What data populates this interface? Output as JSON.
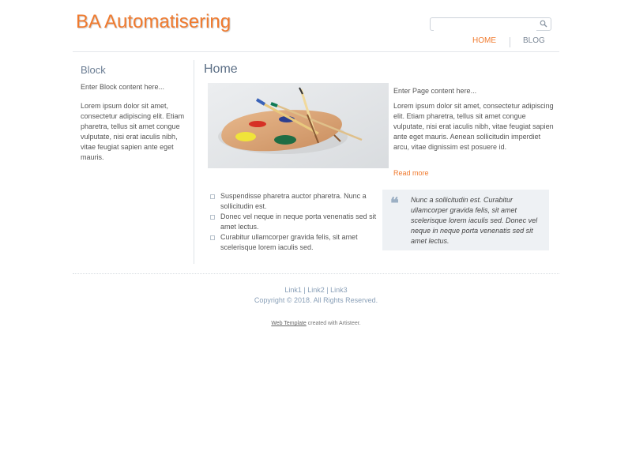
{
  "header": {
    "logo": "BA Automatisering",
    "search": {
      "placeholder": "",
      "value": ""
    },
    "nav": [
      {
        "label": "HOME",
        "active": true
      },
      {
        "label": "BLOG",
        "active": false
      }
    ]
  },
  "sidebar": {
    "title": "Block",
    "text1": "Enter Block content here...",
    "text2": "Lorem ipsum dolor sit amet, consectetur adipiscing elit. Etiam pharetra, tellus sit amet congue vulputate, nisi erat iaculis nibh, vitae feugiat sapien ante eget mauris."
  },
  "main": {
    "title": "Home",
    "intro": "Enter Page content here...",
    "body": "Lorem ipsum dolor sit amet, consectetur adipiscing elit. Etiam pharetra, tellus sit amet congue vulputate, nisi erat iaculis nibh, vitae feugiat sapien ante eget mauris. Aenean sollicitudin imperdiet arcu, vitae dignissim est posuere id.",
    "read_more": "Read more",
    "bullets": [
      "Suspendisse pharetra auctor pharetra. Nunc a sollicitudin est.",
      "Donec vel neque in neque porta venenatis sed sit amet lectus.",
      "Curabitur ullamcorper gravida felis, sit amet scelerisque lorem iaculis sed."
    ],
    "quote": "Nunc a sollicitudin est. Curabitur ullamcorper gravida felis, sit amet scelerisque lorem iaculis sed. Donec vel neque in neque porta venenatis sed sit amet lectus."
  },
  "footer": {
    "link1": "Link1",
    "link2": "Link2",
    "link3": "Link3",
    "separator": " | ",
    "copyright": "Copyright © 2018. All Rights Reserved.",
    "credit_link": "Web Template",
    "credit_text": " created with Artisteer."
  },
  "colors": {
    "accent": "#f07a2e",
    "heading": "#5c6f86",
    "link": "#8aa0b8",
    "quote_bg": "#eef1f4"
  },
  "icons": {
    "search": "search-icon",
    "quote": "quote-icon",
    "bullet": "square-bullet-icon"
  }
}
